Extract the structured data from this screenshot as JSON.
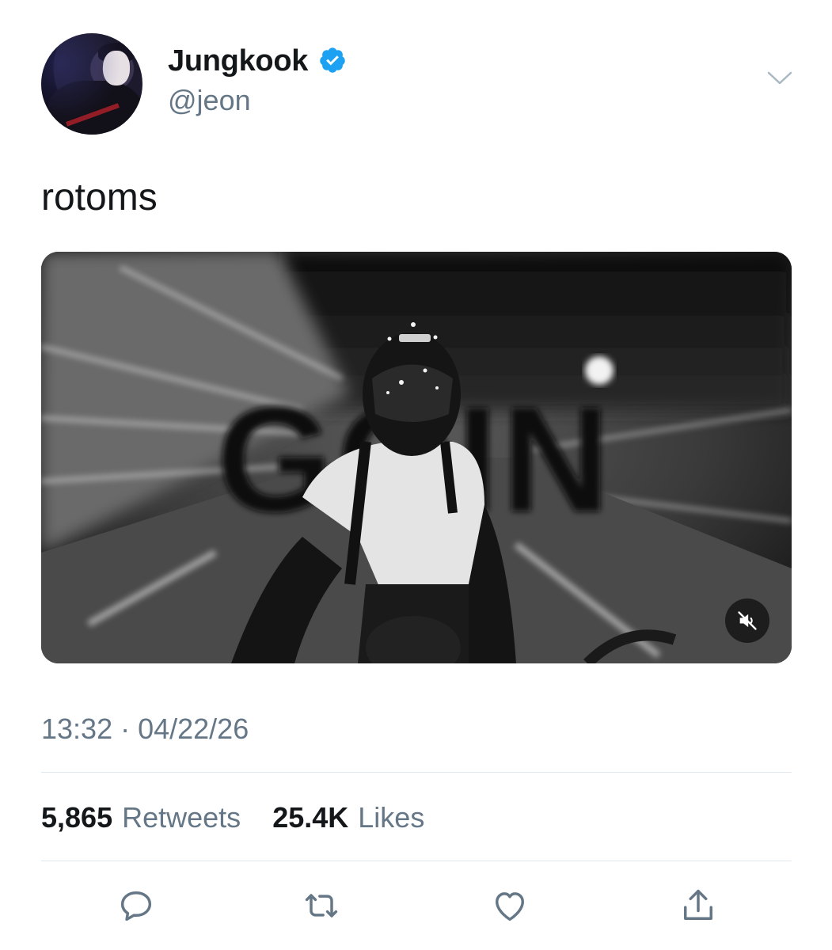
{
  "user": {
    "display_name": "Jungkook",
    "handle": "@jeon",
    "verified": true,
    "verified_color": "#1da1f2"
  },
  "tweet": {
    "text": "rotoms",
    "timestamp": "13:32 · 04/22/26",
    "media": {
      "type": "video",
      "overlay_text": "GOIN",
      "muted": true,
      "mute_icon": "speaker-muted-icon"
    }
  },
  "stats": {
    "retweets_count": "5,865",
    "retweets_label": "Retweets",
    "likes_count": "25.4K",
    "likes_label": "Likes"
  },
  "actions": [
    {
      "name": "reply",
      "icon": "comment-icon"
    },
    {
      "name": "retweet",
      "icon": "retweet-icon"
    },
    {
      "name": "like",
      "icon": "heart-icon"
    },
    {
      "name": "share",
      "icon": "share-icon"
    }
  ],
  "colors": {
    "primary_text": "#14171a",
    "secondary_text": "#657786",
    "divider": "#e1e8ed",
    "icon": "#657786"
  }
}
